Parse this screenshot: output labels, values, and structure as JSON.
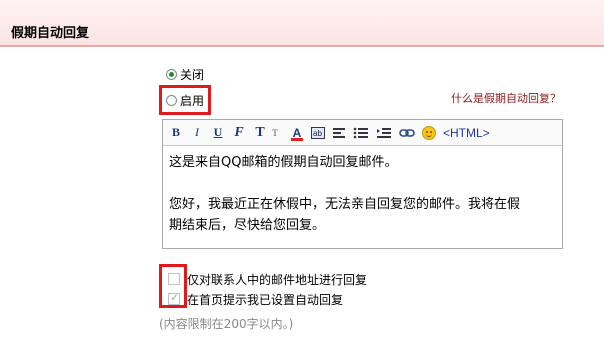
{
  "header": {
    "title": "假期自动回复"
  },
  "options": {
    "off_label": "关闭",
    "on_label": "启用",
    "selected": "off"
  },
  "help_link": "什么是假期自动回复？",
  "toolbar": {
    "bold": "B",
    "italic": "I",
    "underline": "U",
    "font": "F",
    "size": "T",
    "size_small": "T",
    "color": "A",
    "html": "<HTML>"
  },
  "editor": {
    "line1": "这是来自QQ邮箱的假期自动回复邮件。",
    "line2": "您好，我最近正在休假中，无法亲自回复您的邮件。我将在假",
    "line3": "期结束后，尽快给您回复。"
  },
  "checks": [
    {
      "label": "仅对联系人中的邮件地址进行回复",
      "checked": false
    },
    {
      "label": "在首页提示我已设置自动回复",
      "checked": true
    }
  ],
  "note": "(内容限制在200字以内。)",
  "colors": {
    "header_bg": "#fce4e4",
    "highlight": "#e01a1a",
    "link": "#8b1a1a"
  }
}
